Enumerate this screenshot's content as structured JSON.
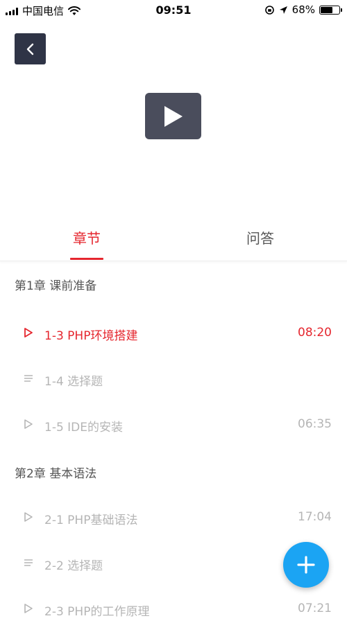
{
  "status_bar": {
    "carrier": "中国电信",
    "time": "09:51",
    "battery_percent": "68%",
    "battery_level": 0.68
  },
  "icons": {
    "back": "chevron-left-icon",
    "play": "play-icon",
    "add": "plus-icon"
  },
  "tabs": [
    {
      "label": "章节",
      "active": true
    },
    {
      "label": "问答",
      "active": false
    }
  ],
  "chapters": [
    {
      "title": "第1章 课前准备",
      "lessons": [
        {
          "icon": "video",
          "title": "1-3 PHP环境搭建",
          "duration": "08:20",
          "active": true
        },
        {
          "icon": "doc",
          "title": "1-4 选择题",
          "duration": "",
          "active": false
        },
        {
          "icon": "video",
          "title": "1-5 IDE的安装",
          "duration": "06:35",
          "active": false
        }
      ]
    },
    {
      "title": "第2章 基本语法",
      "lessons": [
        {
          "icon": "video",
          "title": "2-1 PHP基础语法",
          "duration": "17:04",
          "active": false
        },
        {
          "icon": "doc",
          "title": "2-2 选择题",
          "duration": "",
          "active": false
        },
        {
          "icon": "video",
          "title": "2-3 PHP的工作原理",
          "duration": "07:21",
          "active": false
        }
      ]
    }
  ],
  "colors": {
    "accent": "#e5262e",
    "fab": "#1ba4f3",
    "dark_button": "#2f3446",
    "muted_text": "#b5b5b5"
  }
}
